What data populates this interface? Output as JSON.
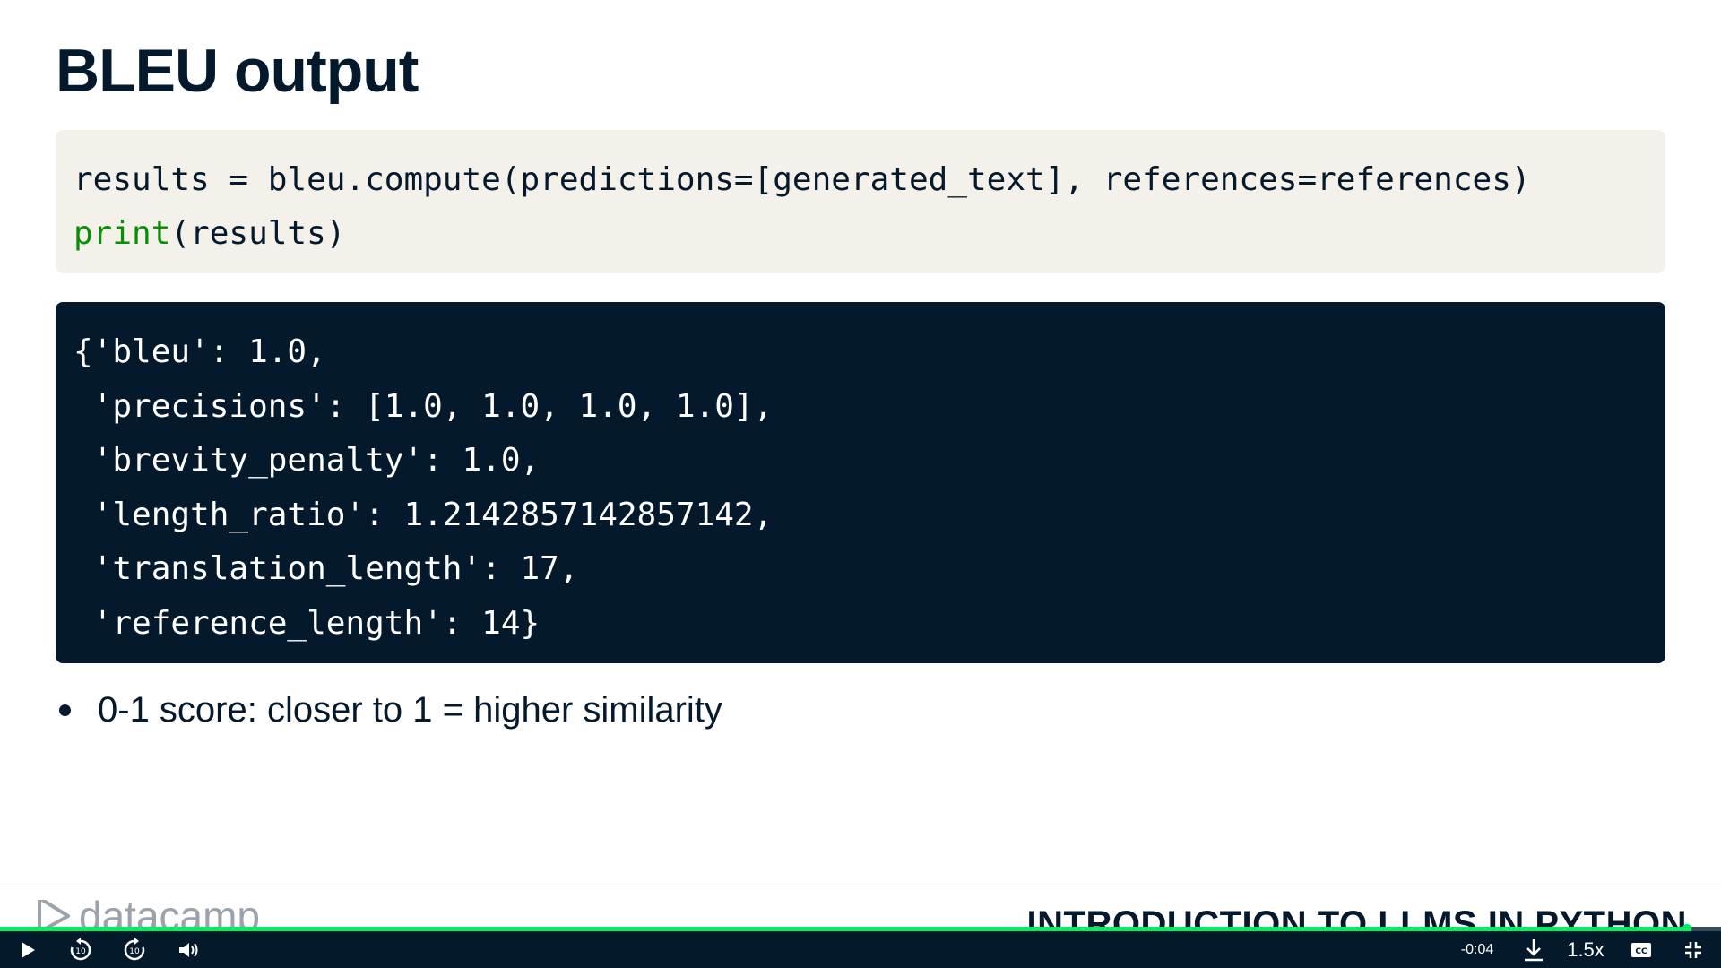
{
  "slide": {
    "title": "BLEU output",
    "code_input": {
      "line1": "results = bleu.compute(predictions=[generated_text], references=references)",
      "line2_keyword": "print",
      "line2_rest": "(results)"
    },
    "code_output": [
      "{'bleu': 1.0,",
      " 'precisions': [1.0, 1.0, 1.0, 1.0],",
      " 'brevity_penalty': 1.0,",
      " 'length_ratio': 1.2142857142857142,",
      " 'translation_length': 17,",
      " 'reference_length': 14}"
    ],
    "bullets": [
      "0-1 score: closer to 1 = higher similarity"
    ]
  },
  "footer": {
    "logo_text": "datacamp",
    "course_title": "INTRODUCTION TO LLMS IN PYTHON"
  },
  "player": {
    "progress_percent": 98,
    "time_remaining": "-0:04",
    "speed": "1.5x",
    "icons": [
      "play-icon",
      "rewind-10-icon",
      "forward-10-icon",
      "volume-icon",
      "download-icon",
      "captions-icon",
      "exit-fullscreen-icon"
    ]
  },
  "colors": {
    "navy": "#05192d",
    "code_bg": "#f4f0ea",
    "accent_green": "#03ef62",
    "keyword_green": "#078f07"
  }
}
